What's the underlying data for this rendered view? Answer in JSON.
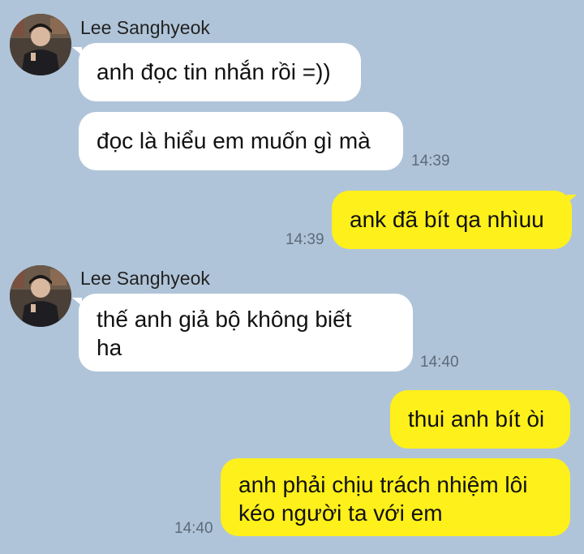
{
  "colors": {
    "background": "#b0c4d9",
    "incoming_bubble": "#ffffff",
    "outgoing_bubble": "#fef01b",
    "timestamp": "#5c6b7a"
  },
  "messages": {
    "group1": {
      "sender": "Lee Sanghyeok",
      "avatar_icon": "profile-photo",
      "m1": "anh đọc tin nhắn rồi =))",
      "m2": "đọc là hiểu em muốn gì mà",
      "time": "14:39"
    },
    "out1": {
      "text": "ank đã bít qa nhìuu",
      "time": "14:39"
    },
    "group2": {
      "sender": "Lee Sanghyeok",
      "avatar_icon": "profile-photo",
      "m1_line1": "thế anh giả bộ không biết",
      "m1_line2": "ha",
      "time": "14:40"
    },
    "out2": {
      "text": "thui anh bít òi"
    },
    "out3": {
      "line1": "anh phải chịu trách nhiệm lôi",
      "line2": "kéo người ta với em",
      "time": "14:40"
    }
  }
}
